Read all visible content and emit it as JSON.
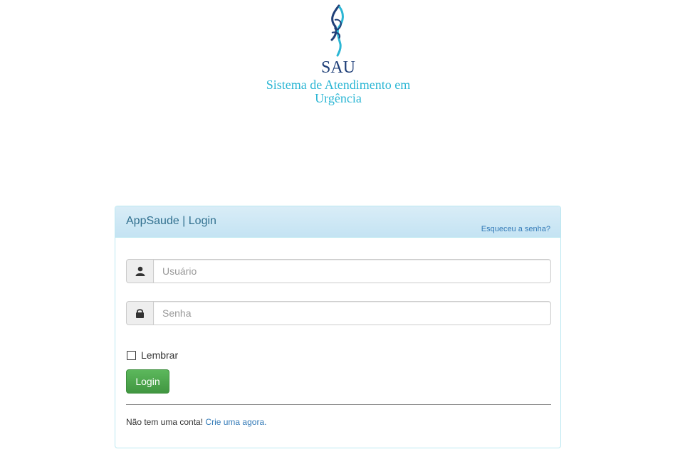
{
  "logo": {
    "abbrev": "SAU",
    "subtitle_line1": "Sistema de Atendimento em",
    "subtitle_line2": "Urgência"
  },
  "panel": {
    "title": "AppSaude | Login",
    "forgot_link": "Esqueceu a senha?"
  },
  "form": {
    "username": {
      "placeholder": "Usuário",
      "value": "",
      "icon": "user-icon"
    },
    "password": {
      "placeholder": "Senha",
      "value": "",
      "icon": "lock-icon"
    },
    "remember_label": "Lembrar",
    "remember_checked": false,
    "login_label": "Login"
  },
  "signup": {
    "text": "Não tem uma conta!",
    "link": "Crie uma agora."
  },
  "colors": {
    "heading_bg": "#d9edf7",
    "heading_text": "#31708f",
    "link": "#337ab7",
    "button": "#5cb85c",
    "logo_dark": "#1f3f78",
    "logo_light": "#2bb6d4"
  }
}
